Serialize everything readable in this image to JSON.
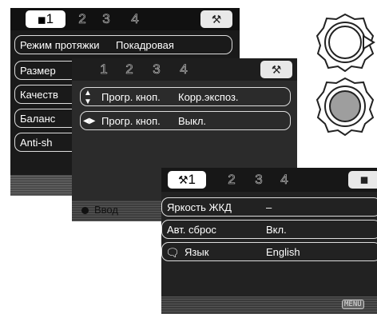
{
  "screen1": {
    "tabs": [
      "1",
      "2",
      "3",
      "4"
    ],
    "rows": [
      {
        "label": "Режим протяжки",
        "value": "Покадровая"
      },
      {
        "label": "Размер",
        "value": ""
      },
      {
        "label": "Качеств",
        "value": ""
      },
      {
        "label": "Баланс",
        "value": ""
      },
      {
        "label": "Anti-sh",
        "value": ""
      }
    ]
  },
  "screen2": {
    "tabs": [
      "1",
      "2",
      "3",
      "4"
    ],
    "rows": [
      {
        "label": "Прогр. кноп.",
        "value": "Корр.экспоз."
      },
      {
        "label": "Прогр. кноп.",
        "value": "Выкл."
      }
    ],
    "footer_label": "Ввод"
  },
  "screen3": {
    "tabs": [
      "1",
      "2",
      "3",
      "4"
    ],
    "rows": [
      {
        "label": "Яркость ЖКД",
        "value": "–"
      },
      {
        "label": "Авт. сброс",
        "value": "Вкл."
      },
      {
        "label": "Язык",
        "value": "English"
      }
    ],
    "footer_label": "MENU"
  },
  "icons": {
    "camera": "camera-icon",
    "wrench": "wrench-icon",
    "updown": "up-down-arrow-icon",
    "leftright": "left-right-arrow-icon",
    "speech": "speech-bubble-icon"
  }
}
